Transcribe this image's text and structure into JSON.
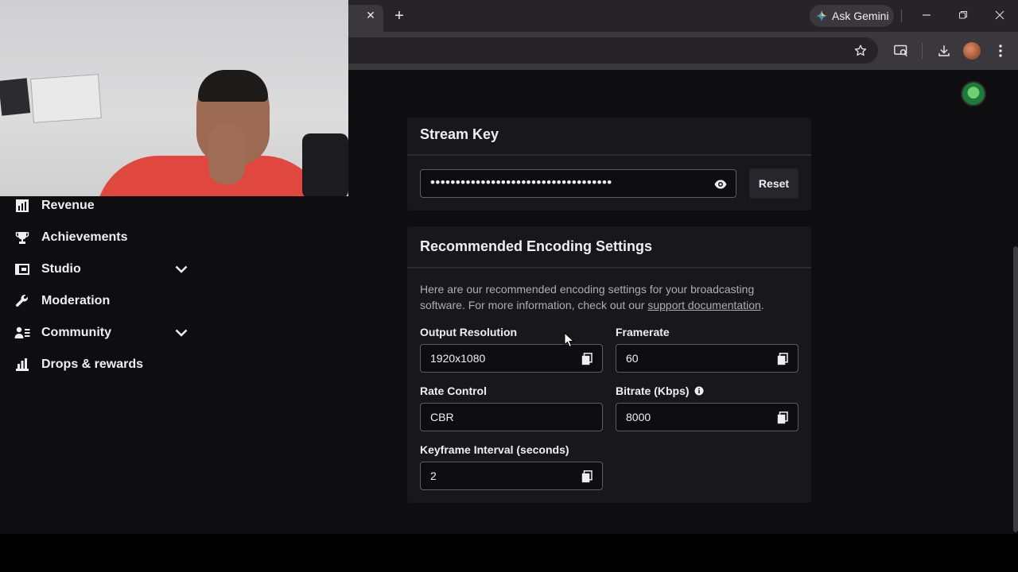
{
  "browser": {
    "ask_gemini_label": "Ask Gemini",
    "new_tab_symbol": "+",
    "tab_close_symbol": "✕"
  },
  "sidebar": {
    "items": [
      {
        "label": "Revenue",
        "icon": "revenue-chart-icon",
        "has_chevron": false
      },
      {
        "label": "Achievements",
        "icon": "trophy-icon",
        "has_chevron": false
      },
      {
        "label": "Studio",
        "icon": "studio-icon",
        "has_chevron": true
      },
      {
        "label": "Moderation",
        "icon": "wrench-icon",
        "has_chevron": false
      },
      {
        "label": "Community",
        "icon": "community-icon",
        "has_chevron": true
      },
      {
        "label": "Drops & rewards",
        "icon": "drops-icon",
        "has_chevron": false
      }
    ]
  },
  "stream_key": {
    "title": "Stream Key",
    "masked_value": "••••••••••••••••••••••••••••••••••••",
    "reset_label": "Reset"
  },
  "encoding": {
    "title": "Recommended Encoding Settings",
    "description_prefix": "Here are our recommended encoding settings for your broadcasting software. For more information, check out our ",
    "description_link": "support documentation",
    "description_suffix": ".",
    "fields": {
      "output_resolution": {
        "label": "Output Resolution",
        "value": "1920x1080"
      },
      "framerate": {
        "label": "Framerate",
        "value": "60"
      },
      "rate_control": {
        "label": "Rate Control",
        "value": "CBR"
      },
      "bitrate": {
        "label": "Bitrate (Kbps)",
        "value": "8000"
      },
      "keyframe_interval": {
        "label": "Keyframe Interval (seconds)",
        "value": "2"
      }
    }
  },
  "colors": {
    "page_background": "#0e0e10",
    "card_background": "#18181b",
    "text_primary": "#efeff1",
    "text_secondary": "#adadb8",
    "field_border": "#5c5c63"
  }
}
